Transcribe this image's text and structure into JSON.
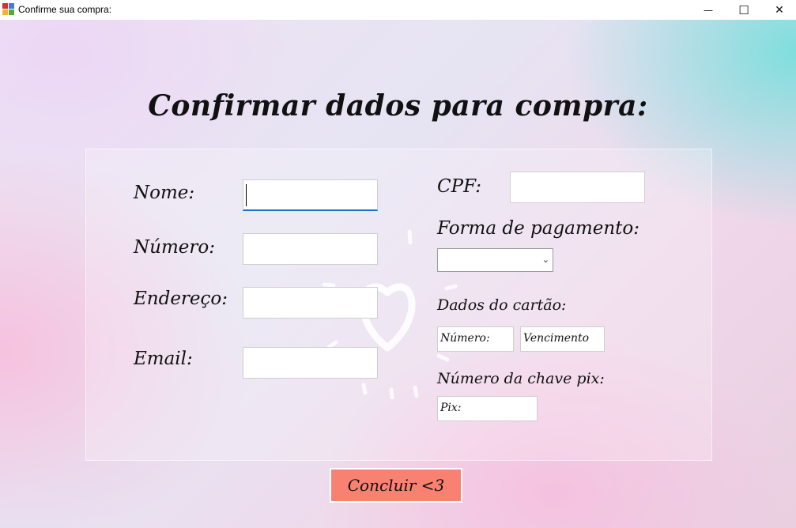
{
  "window": {
    "title": "Confirme sua compra:",
    "minimize_glyph": "—",
    "maximize_glyph": "☐",
    "close_glyph": "✕"
  },
  "form": {
    "heading": "Confirmar dados para compra:",
    "nome_label": "Nome:",
    "nome_value": "",
    "numero_label": "Número:",
    "numero_value": "",
    "endereco_label": "Endereço:",
    "endereco_value": "",
    "email_label": "Email:",
    "email_value": "",
    "cpf_label": "CPF:",
    "cpf_value": "",
    "pagamento_label": "Forma de pagamento:",
    "pagamento_selected": "",
    "cartao_label": "Dados do cartão:",
    "cartao_numero_value": "Número:",
    "cartao_vencimento_value": "Vencimento",
    "pix_label": "Número da chave pix:",
    "pix_value": "Pix:",
    "submit_label": "Concluir <3"
  },
  "colors": {
    "submit_bg": "#f88172",
    "focus_accent": "#1a6fc9",
    "teal_glow": "#78dedc",
    "pink_glow": "#f8bedc"
  },
  "icons": {
    "app": "winforms-app-icon",
    "decoration": "heart-icon"
  }
}
